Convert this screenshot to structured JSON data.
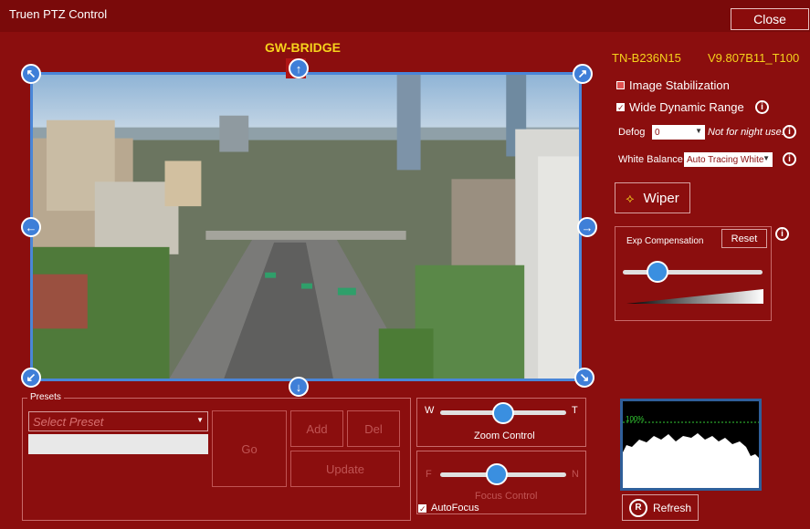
{
  "window": {
    "title": "Truen PTZ Control",
    "close_label": "Close"
  },
  "camera": {
    "name": "GW-BRIDGE"
  },
  "device": {
    "model": "TN-B236N15",
    "version": "V9.807B11_T100"
  },
  "settings": {
    "image_stabilization": {
      "label": "Image Stabilization",
      "checked": false
    },
    "wdr": {
      "label": "Wide Dynamic Range",
      "checked": true
    },
    "defog": {
      "label": "Defog",
      "value": "0",
      "note": "Not for night use!"
    },
    "white_balance": {
      "label": "White Balance",
      "value": "Auto Tracing White"
    },
    "wiper_label": "Wiper"
  },
  "exposure": {
    "label": "Exp Compensation",
    "reset_label": "Reset",
    "level": 0.25
  },
  "presets": {
    "group_label": "Presets",
    "select_placeholder": "Select Preset",
    "go_label": "Go",
    "add_label": "Add",
    "del_label": "Del",
    "update_label": "Update"
  },
  "zoom": {
    "left": "W",
    "right": "T",
    "label": "Zoom Control",
    "level": 0.5
  },
  "focus": {
    "left": "F",
    "right": "N",
    "label": "Focus Control",
    "level": 0.45,
    "autofocus_label": "AutoFocus",
    "autofocus": true
  },
  "histogram": {
    "percent_label": "100%"
  },
  "refresh_label": "Refresh",
  "colors": {
    "accent": "#f6d21c",
    "background": "#8b0e0e",
    "frame": "#4a86d8"
  }
}
